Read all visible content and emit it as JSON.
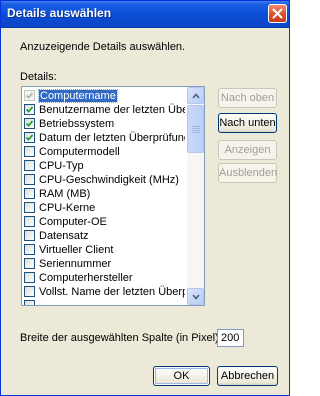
{
  "window": {
    "title": "Details auswählen"
  },
  "description": "Anzuzeigende Details auswählen.",
  "details_label": "Details:",
  "items": [
    {
      "label": "Computername",
      "checked": true,
      "disabled": true,
      "selected": true
    },
    {
      "label": "Benutzername der letzten Überprüfung",
      "checked": true,
      "disabled": false,
      "selected": false
    },
    {
      "label": "Betriebssystem",
      "checked": true,
      "disabled": false,
      "selected": false
    },
    {
      "label": "Datum der letzten Überprüfung",
      "checked": true,
      "disabled": false,
      "selected": false
    },
    {
      "label": "Computermodell",
      "checked": false,
      "disabled": false,
      "selected": false
    },
    {
      "label": "CPU-Typ",
      "checked": false,
      "disabled": false,
      "selected": false
    },
    {
      "label": "CPU-Geschwindigkeit (MHz)",
      "checked": false,
      "disabled": false,
      "selected": false
    },
    {
      "label": "RAM (MB)",
      "checked": false,
      "disabled": false,
      "selected": false
    },
    {
      "label": "CPU-Kerne",
      "checked": false,
      "disabled": false,
      "selected": false
    },
    {
      "label": "Computer-OE",
      "checked": false,
      "disabled": false,
      "selected": false
    },
    {
      "label": "Datensatz",
      "checked": false,
      "disabled": false,
      "selected": false
    },
    {
      "label": "Virtueller Client",
      "checked": false,
      "disabled": false,
      "selected": false
    },
    {
      "label": "Seriennummer",
      "checked": false,
      "disabled": false,
      "selected": false
    },
    {
      "label": "Computerhersteller",
      "checked": false,
      "disabled": false,
      "selected": false
    },
    {
      "label": "Vollst. Name der letzten Überprüfung",
      "checked": false,
      "disabled": false,
      "selected": false
    },
    {
      "label": "",
      "checked": false,
      "disabled": false,
      "selected": false
    }
  ],
  "buttons": {
    "move_up": "Nach oben",
    "move_down": "Nach unten",
    "show": "Anzeigen",
    "hide": "Ausblenden",
    "ok": "OK",
    "cancel": "Abbrechen"
  },
  "column_width": {
    "label": "Breite der ausgewählten Spalte (in Pixel):",
    "value": "200"
  },
  "colors": {
    "titlebar": "#0a50d8",
    "selection": "#316ac5",
    "check": "#21a121"
  }
}
